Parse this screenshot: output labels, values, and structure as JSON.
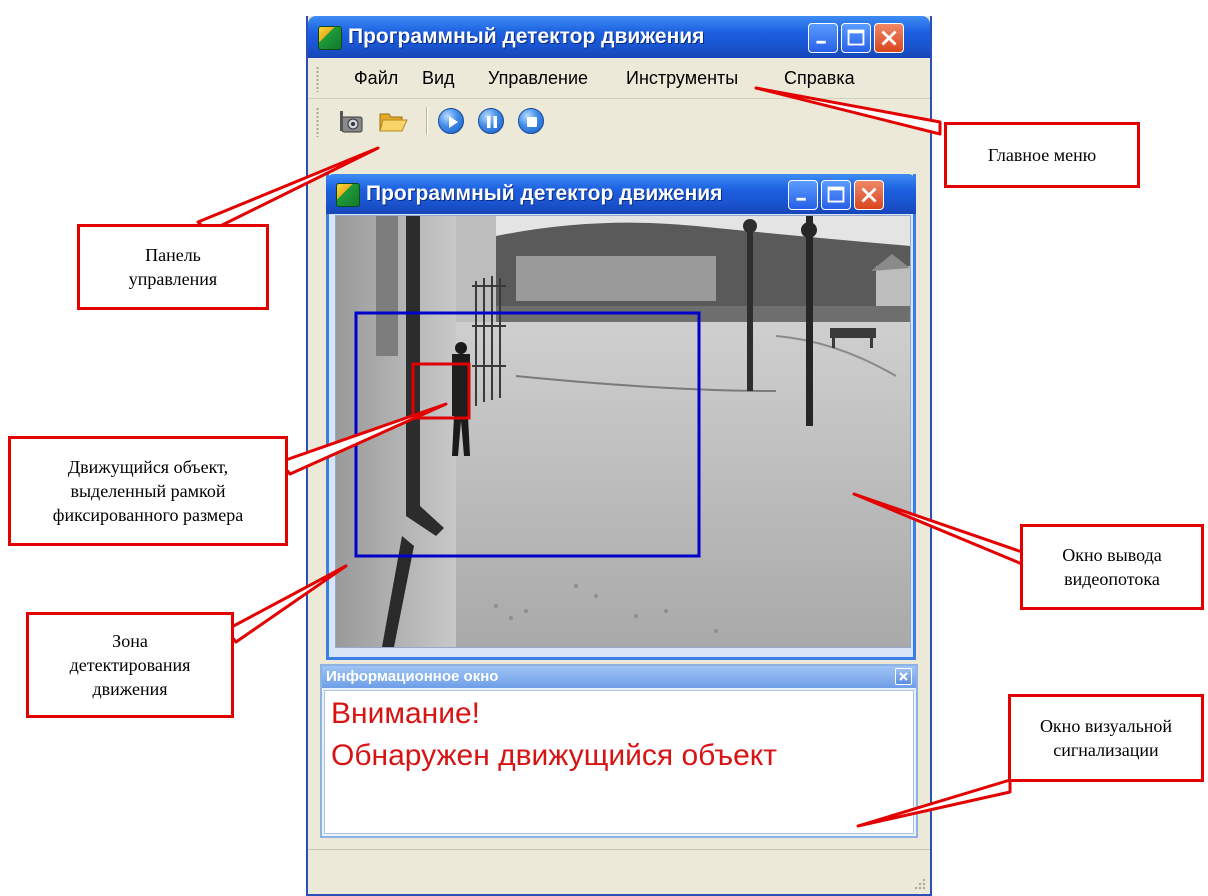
{
  "app": {
    "title": "Программный детектор движения",
    "menu": [
      "Файл",
      "Вид",
      "Управление",
      "Инструменты",
      "Справка"
    ],
    "toolbar_icons": [
      "camera-icon",
      "folder-open-icon",
      "play-icon",
      "pause-icon",
      "stop-icon"
    ]
  },
  "child_window": {
    "title": "Программный детектор движения"
  },
  "info_window": {
    "title": "Информационное окно",
    "alert_line1": "Внимание!",
    "alert_line2": "Обнаружен движущийся объект"
  },
  "callouts": {
    "main_menu": "Главное меню",
    "control_panel": [
      "Панель",
      "управления"
    ],
    "moving_object": [
      "Движущийся объект,",
      "выделенный рамкой",
      "фиксированного размера"
    ],
    "video_window": [
      "Окно вывода",
      "видеопотока"
    ],
    "detection_zone": [
      "Зона",
      "детектирования",
      "движения"
    ],
    "visual_alarm": [
      "Окно визуальной",
      "сигнализации"
    ]
  },
  "colors": {
    "callout_border": "#e30000",
    "detection_zone_frame": "#0000cc",
    "object_frame": "#e00000",
    "alert_text": "#d71414",
    "titlebar": "#1c5fe0"
  }
}
